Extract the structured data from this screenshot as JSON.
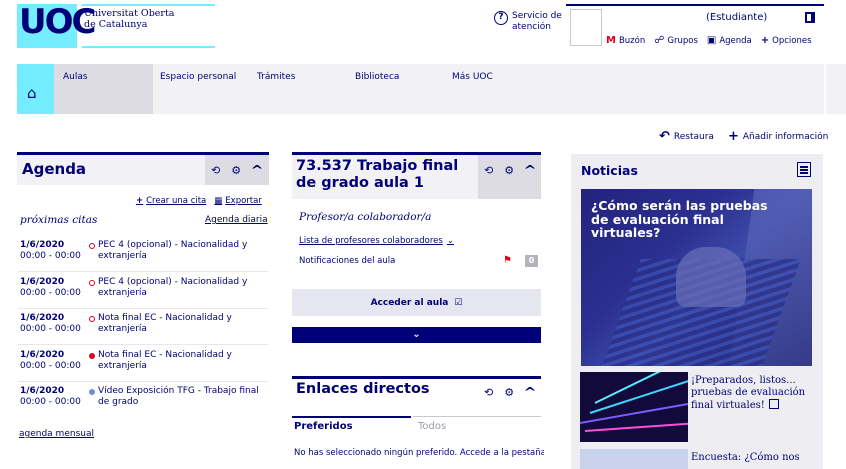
{
  "header": {
    "logo": "UOC",
    "university": [
      "Universitat Oberta",
      "de Catalunya"
    ],
    "help": {
      "icon": "help-circle-icon",
      "label": [
        "Servicio de",
        "atención"
      ]
    },
    "user": {
      "role": "(Estudiante)",
      "logout_icon": "logout-icon",
      "links": [
        {
          "icon": "mail-icon",
          "label": "Buzón"
        },
        {
          "icon": "groups-icon",
          "label": "Grupos"
        },
        {
          "icon": "calendar-icon",
          "label": "Agenda"
        },
        {
          "icon": "plus-icon",
          "label": "Opciones"
        }
      ]
    }
  },
  "nav": {
    "home_icon": "home-icon",
    "items": [
      "Aulas",
      "Espacio personal",
      "Trámites",
      "Biblioteca",
      "Más UOC"
    ]
  },
  "actions": {
    "restore": "Restaura",
    "add": "Añadir información"
  },
  "agenda": {
    "title": "Agenda",
    "create": "Crear una cita",
    "export": "Exportar",
    "upcoming": "próximas citas",
    "daily": "Agenda diaria",
    "items": [
      {
        "date": "1/6/2020",
        "time": "00:00 - 00:00",
        "text": "PEC 4 (opcional) - Nacionalidad y extranjería",
        "dot": "ring"
      },
      {
        "date": "1/6/2020",
        "time": "00:00 - 00:00",
        "text": "PEC 4 (opcional) - Nacionalidad y extranjería",
        "dot": "ring"
      },
      {
        "date": "1/6/2020",
        "time": "00:00 - 00:00",
        "text": "Nota final EC - Nacionalidad y extranjería",
        "dot": "ring"
      },
      {
        "date": "1/6/2020",
        "time": "00:00 - 00:00",
        "text": "Nota final EC - Nacionalidad y extranjería",
        "dot": "solid"
      },
      {
        "date": "1/6/2020",
        "time": "00:00 - 00:00",
        "text": "Vídeo Exposición TFG - Trabajo final de grado",
        "dot": "blue"
      }
    ],
    "monthly": "agenda mensual"
  },
  "course": {
    "title": "73.537 Trabajo final de grado aula 1",
    "role": "Profesor/a colaborador/a",
    "teachers_list": "Lista de profesores colaboradores",
    "notifications": "Notificaciones del aula",
    "badge": "0",
    "access": "Acceder al aula"
  },
  "links_widget": {
    "title": "Enlaces directos",
    "tab_favorites": "Preferidos",
    "tab_all": "Todos",
    "empty_text": "No has seleccionado ningún preferido. Accede a la pestaña"
  },
  "news": {
    "title": "Noticias",
    "headline": "¿Cómo serán las pruebas de evaluación final virtuales?",
    "item1": "¡Preparados, listos... pruebas de evaluación final virtuales!",
    "item2": "Encuesta: ¿Cómo nos"
  },
  "colors": {
    "primary": "#000078",
    "accent": "#73edff",
    "alert": "#e2001a"
  }
}
